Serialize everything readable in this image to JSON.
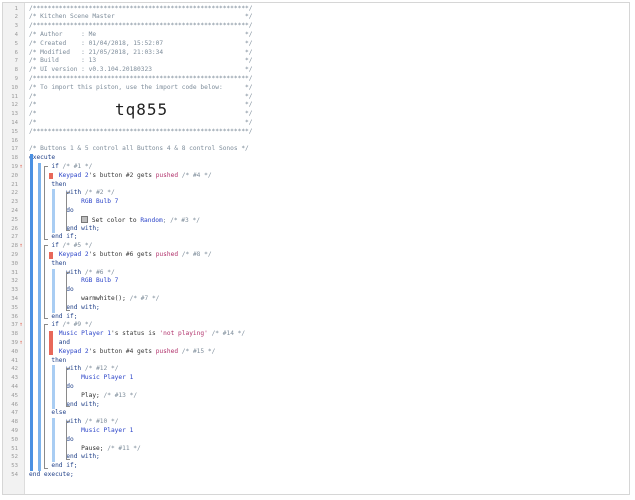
{
  "editor": {
    "lines": [
      [
        {
          "t": "/**********************************************************/",
          "c": "cmt"
        }
      ],
      [
        {
          "t": "/* Kitchen Scene Master                                   */",
          "c": "cmt"
        }
      ],
      [
        {
          "t": "/**********************************************************/",
          "c": "cmt"
        }
      ],
      [
        {
          "t": "/* Author     : Me                                        */",
          "c": "cmt"
        }
      ],
      [
        {
          "t": "/* Created    : 01/04/2018, 15:52:07                      */",
          "c": "cmt"
        }
      ],
      [
        {
          "t": "/* Modified   : 21/05/2018, 21:03:34                      */",
          "c": "cmt"
        }
      ],
      [
        {
          "t": "/* Build      : 13                                        */",
          "c": "cmt"
        }
      ],
      [
        {
          "t": "/* UI version : v0.3.104.20180323                         */",
          "c": "cmt"
        }
      ],
      [
        {
          "t": "/**********************************************************/",
          "c": "cmt"
        }
      ],
      [
        {
          "t": "/* To import this piston, use the import code below:      */",
          "c": "cmt"
        }
      ],
      [
        {
          "t": "/*                                                        */",
          "c": "cmt"
        }
      ],
      [
        {
          "t": "/*                                                        */",
          "c": "cmt"
        }
      ],
      [
        {
          "t": "/*                                                        */",
          "c": "cmt"
        }
      ],
      [
        {
          "t": "/*                                                        */",
          "c": "cmt"
        }
      ],
      [
        {
          "t": "/**********************************************************/",
          "c": "cmt"
        }
      ],
      [
        {
          "t": "",
          "c": "op"
        }
      ],
      [
        {
          "t": "/* Buttons 1 & 5 control all Buttons 4 & 8 control Sonos */",
          "c": "cmt"
        }
      ],
      [
        {
          "t": "execute",
          "c": "kw"
        }
      ],
      [
        {
          "t": "      if ",
          "c": "kw"
        },
        {
          "t": "/* #1 */",
          "c": "cmt"
        }
      ],
      [
        {
          "t": "        ",
          "c": "op"
        },
        {
          "t": "Keypad 2",
          "c": "dev"
        },
        {
          "t": "'s button #2 gets ",
          "c": "op"
        },
        {
          "t": "pushed",
          "c": "lit"
        },
        {
          "t": " /* #4 */",
          "c": "cmt"
        }
      ],
      [
        {
          "t": "      then",
          "c": "kw"
        }
      ],
      [
        {
          "t": "          with ",
          "c": "kw"
        },
        {
          "t": "/* #2 */",
          "c": "cmt"
        }
      ],
      [
        {
          "t": "              ",
          "c": "op"
        },
        {
          "t": "RGB Bulb 7",
          "c": "dev"
        }
      ],
      [
        {
          "t": "          do",
          "c": "kw"
        }
      ],
      [
        {
          "t": "              ",
          "c": "op"
        },
        {
          "t": "SW",
          "c": "swatch"
        },
        {
          "t": " Set color to ",
          "c": "fn"
        },
        {
          "t": "Random",
          "c": "dev"
        },
        {
          "t": "; /* #3 */",
          "c": "cmt"
        }
      ],
      [
        {
          "t": "          end with;",
          "c": "kw"
        }
      ],
      [
        {
          "t": "      end if;",
          "c": "kw"
        }
      ],
      [
        {
          "t": "      if ",
          "c": "kw"
        },
        {
          "t": "/* #5 */",
          "c": "cmt"
        }
      ],
      [
        {
          "t": "        ",
          "c": "op"
        },
        {
          "t": "Keypad 2",
          "c": "dev"
        },
        {
          "t": "'s button #6 gets ",
          "c": "op"
        },
        {
          "t": "pushed",
          "c": "lit"
        },
        {
          "t": " /* #8 */",
          "c": "cmt"
        }
      ],
      [
        {
          "t": "      then",
          "c": "kw"
        }
      ],
      [
        {
          "t": "          with ",
          "c": "kw"
        },
        {
          "t": "/* #6 */",
          "c": "cmt"
        }
      ],
      [
        {
          "t": "              ",
          "c": "op"
        },
        {
          "t": "RGB Bulb 7",
          "c": "dev"
        }
      ],
      [
        {
          "t": "          do",
          "c": "kw"
        }
      ],
      [
        {
          "t": "              warmwhite(); ",
          "c": "fn"
        },
        {
          "t": "/* #7 */",
          "c": "cmt"
        }
      ],
      [
        {
          "t": "          end with;",
          "c": "kw"
        }
      ],
      [
        {
          "t": "      end if;",
          "c": "kw"
        }
      ],
      [
        {
          "t": "      if ",
          "c": "kw"
        },
        {
          "t": "/* #9 */",
          "c": "cmt"
        }
      ],
      [
        {
          "t": "        ",
          "c": "op"
        },
        {
          "t": "Music Player 1",
          "c": "dev"
        },
        {
          "t": "'s status is ",
          "c": "op"
        },
        {
          "t": "'not playing'",
          "c": "lit"
        },
        {
          "t": " /* #14 */",
          "c": "cmt"
        }
      ],
      [
        {
          "t": "        and",
          "c": "kw"
        }
      ],
      [
        {
          "t": "        ",
          "c": "op"
        },
        {
          "t": "Keypad 2",
          "c": "dev"
        },
        {
          "t": "'s button #4 gets ",
          "c": "op"
        },
        {
          "t": "pushed",
          "c": "lit"
        },
        {
          "t": " /* #15 */",
          "c": "cmt"
        }
      ],
      [
        {
          "t": "      then",
          "c": "kw"
        }
      ],
      [
        {
          "t": "          with ",
          "c": "kw"
        },
        {
          "t": "/* #12 */",
          "c": "cmt"
        }
      ],
      [
        {
          "t": "              ",
          "c": "op"
        },
        {
          "t": "Music Player 1",
          "c": "dev"
        }
      ],
      [
        {
          "t": "          do",
          "c": "kw"
        }
      ],
      [
        {
          "t": "              Play; ",
          "c": "fn"
        },
        {
          "t": "/* #13 */",
          "c": "cmt"
        }
      ],
      [
        {
          "t": "          end with;",
          "c": "kw"
        }
      ],
      [
        {
          "t": "      else",
          "c": "kw"
        }
      ],
      [
        {
          "t": "          with ",
          "c": "kw"
        },
        {
          "t": "/* #10 */",
          "c": "cmt"
        }
      ],
      [
        {
          "t": "              ",
          "c": "op"
        },
        {
          "t": "Music Player 1",
          "c": "dev"
        }
      ],
      [
        {
          "t": "          do",
          "c": "kw"
        }
      ],
      [
        {
          "t": "              Pause; ",
          "c": "fn"
        },
        {
          "t": "/* #11 */",
          "c": "cmt"
        }
      ],
      [
        {
          "t": "          end with;",
          "c": "kw"
        }
      ],
      [
        {
          "t": "      end if;",
          "c": "kw"
        }
      ],
      [
        {
          "t": "end execute;",
          "c": "kw"
        }
      ]
    ],
    "import_code": "tq855",
    "marker_lines": [
      19,
      28,
      37,
      39
    ],
    "marker_glyph": "↑"
  },
  "colors": {
    "bar_execute": "#4a90e2",
    "bar_if": "#7db3ec",
    "bar_with": "#a9cdf3",
    "condition_marker": "#e8685a"
  }
}
